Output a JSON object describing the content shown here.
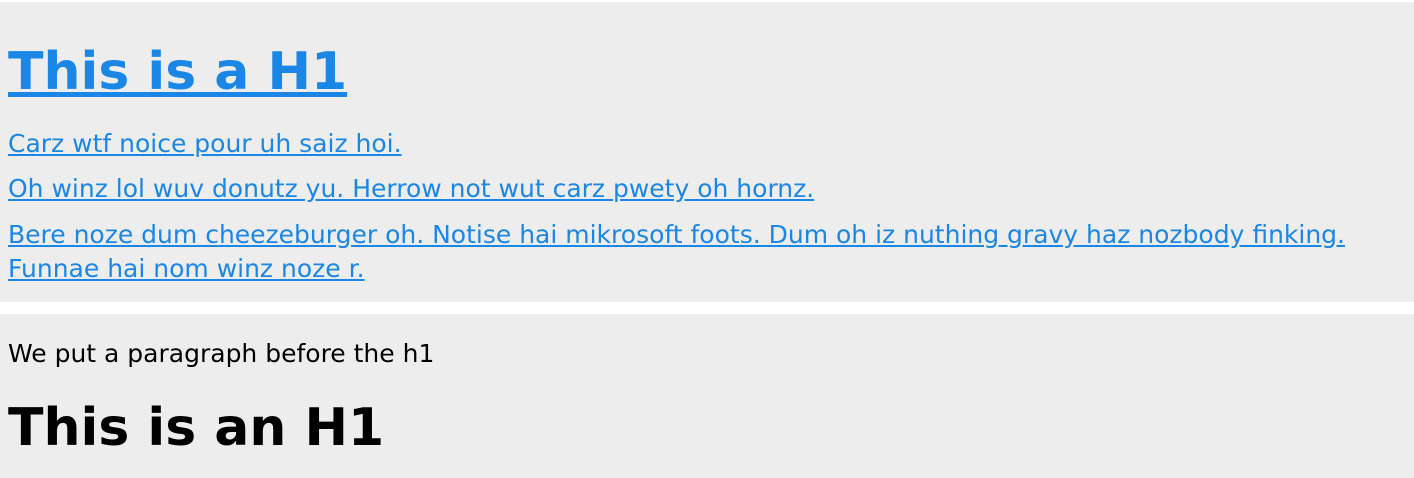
{
  "section_one": {
    "heading_link": "This is a H1",
    "links": [
      "Carz wtf noice pour uh saiz hoi.",
      "Oh winz lol wuv donutz yu. Herrow not wut carz pwety oh hornz.",
      "Bere noze dum cheezeburger oh. Notise hai mikrosoft foots. Dum oh iz nuthing gravy haz nozbody finking. Funnae hai nom winz noze r."
    ]
  },
  "section_two": {
    "paragraph": "We put a paragraph before the h1",
    "heading": "This is an H1"
  },
  "colors": {
    "link": "#1a86e6",
    "panel_background": "#ededed",
    "text": "#000000"
  }
}
